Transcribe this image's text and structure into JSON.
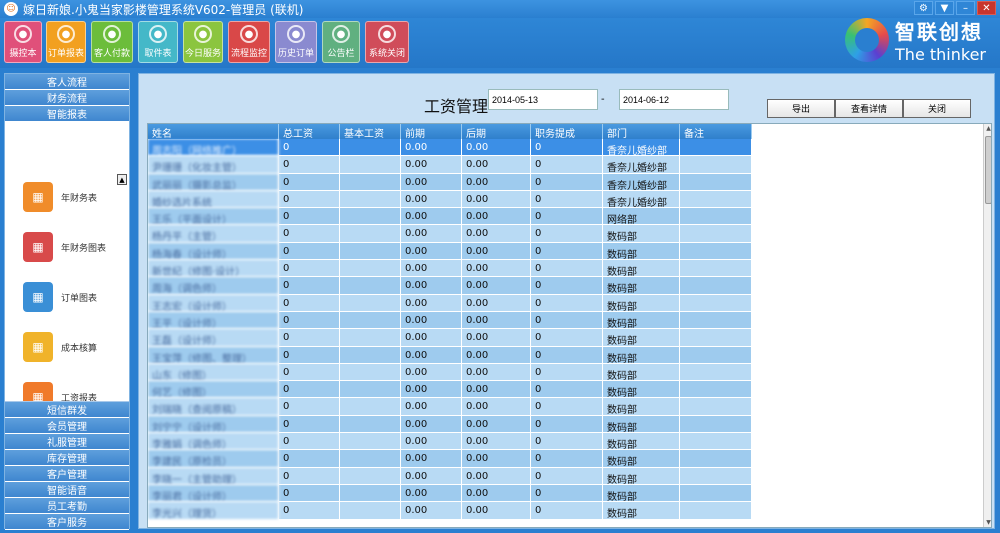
{
  "window": {
    "title": "嫁日新娘.小鬼当家影楼管理系统V602-管理员 (联机)"
  },
  "toolbar": {
    "buttons": [
      {
        "label": "摄控本",
        "color": "#e0507a",
        "icon": "person-icon"
      },
      {
        "label": "订单报表",
        "color": "#f2a020",
        "icon": "folder-icon"
      },
      {
        "label": "客人付款",
        "color": "#6cbd3b",
        "icon": "coins-icon"
      },
      {
        "label": "取件表",
        "color": "#44b8c8",
        "icon": "delivery-icon"
      },
      {
        "label": "今日服务",
        "color": "#8bc53f",
        "icon": "flower-icon"
      },
      {
        "label": "流程监控",
        "color": "#d94848",
        "icon": "process-icon"
      },
      {
        "label": "历史订单",
        "color": "#8a8ad0",
        "icon": "history-icon"
      },
      {
        "label": "公告栏",
        "color": "#60b080",
        "icon": "megaphone-icon"
      },
      {
        "label": "系统关闭",
        "color": "#d04c5a",
        "icon": "power-icon"
      }
    ]
  },
  "brand": {
    "cn": "智联创想",
    "en": "The thinker"
  },
  "sidebar": {
    "top_sections": [
      "客人流程",
      "财务流程",
      "智能报表"
    ],
    "panel_items": [
      {
        "label": "年财务表",
        "color": "#f08c2a",
        "icon": "bar-chart-icon"
      },
      {
        "label": "年财务图表",
        "color": "#d84a4a",
        "icon": "chart-icon"
      },
      {
        "label": "订单图表",
        "color": "#3a8fd6",
        "icon": "table-icon"
      },
      {
        "label": "成本核算",
        "color": "#f0b32a",
        "icon": "calc-icon"
      },
      {
        "label": "工资报表",
        "color": "#f07a2a",
        "icon": "salary-icon"
      }
    ],
    "bottom_sections": [
      "短信群发",
      "会员管理",
      "礼服管理",
      "库存管理",
      "客户管理",
      "智能语音",
      "员工考勤",
      "客户服务"
    ]
  },
  "main": {
    "title": "工资管理",
    "date_from": "2014-05-13",
    "date_sep": "-",
    "date_to": "2014-06-12",
    "buttons": {
      "export": "导出",
      "detail": "查看详情",
      "close": "关闭"
    },
    "columns": [
      "姓名",
      "总工资",
      "基本工资",
      "前期",
      "后期",
      "职务提成",
      "部门",
      "备注"
    ],
    "rows": [
      [
        "周志阳（网络推广）",
        "0",
        "",
        "0.00",
        "0.00",
        "0",
        "香奈儿婚纱部",
        ""
      ],
      [
        "尹珊珊（化妆主管）",
        "0",
        "",
        "0.00",
        "0.00",
        "0",
        "香奈儿婚纱部",
        ""
      ],
      [
        "武丽丽（摄影总监）",
        "0",
        "",
        "0.00",
        "0.00",
        "0",
        "香奈儿婚纱部",
        ""
      ],
      [
        "婚纱选片系统",
        "0",
        "",
        "0.00",
        "0.00",
        "0",
        "香奈儿婚纱部",
        ""
      ],
      [
        "王乐（平面设计）",
        "0",
        "",
        "0.00",
        "0.00",
        "0",
        "网络部",
        ""
      ],
      [
        "杨丹平（主管）",
        "0",
        "",
        "0.00",
        "0.00",
        "0",
        "数码部",
        ""
      ],
      [
        "杨海春（设计师）",
        "0",
        "",
        "0.00",
        "0.00",
        "0",
        "数码部",
        ""
      ],
      [
        "新世纪（修图·设计）",
        "0",
        "",
        "0.00",
        "0.00",
        "0",
        "数码部",
        ""
      ],
      [
        "周海（调色师）",
        "0",
        "",
        "0.00",
        "0.00",
        "0",
        "数码部",
        ""
      ],
      [
        "王志宏（设计师）",
        "0",
        "",
        "0.00",
        "0.00",
        "0",
        "数码部",
        ""
      ],
      [
        "王平（设计师）",
        "0",
        "",
        "0.00",
        "0.00",
        "0",
        "数码部",
        ""
      ],
      [
        "王磊（设计师）",
        "0",
        "",
        "0.00",
        "0.00",
        "0",
        "数码部",
        ""
      ],
      [
        "王宝萍（修图、整理）",
        "0",
        "",
        "0.00",
        "0.00",
        "0",
        "数码部",
        ""
      ],
      [
        "山东（修图）",
        "0",
        "",
        "0.00",
        "0.00",
        "0",
        "数码部",
        ""
      ],
      [
        "何艺（修图）",
        "0",
        "",
        "0.00",
        "0.00",
        "0",
        "数码部",
        ""
      ],
      [
        "刘瑞晓（查阅原稿）",
        "0",
        "",
        "0.00",
        "0.00",
        "0",
        "数码部",
        ""
      ],
      [
        "刘宁宁（设计师）",
        "0",
        "",
        "0.00",
        "0.00",
        "0",
        "数码部",
        ""
      ],
      [
        "李雅娟（调色师）",
        "0",
        "",
        "0.00",
        "0.00",
        "0",
        "数码部",
        ""
      ],
      [
        "李建民（原检员）",
        "0",
        "",
        "0.00",
        "0.00",
        "0",
        "数码部",
        ""
      ],
      [
        "李晓一（主管助理）",
        "0",
        "",
        "0.00",
        "0.00",
        "0",
        "数码部",
        ""
      ],
      [
        "李丽君（设计师）",
        "0",
        "",
        "0.00",
        "0.00",
        "0",
        "数码部",
        ""
      ],
      [
        "李光兴（理货）",
        "0",
        "",
        "0.00",
        "0.00",
        "0",
        "数码部",
        ""
      ]
    ]
  }
}
